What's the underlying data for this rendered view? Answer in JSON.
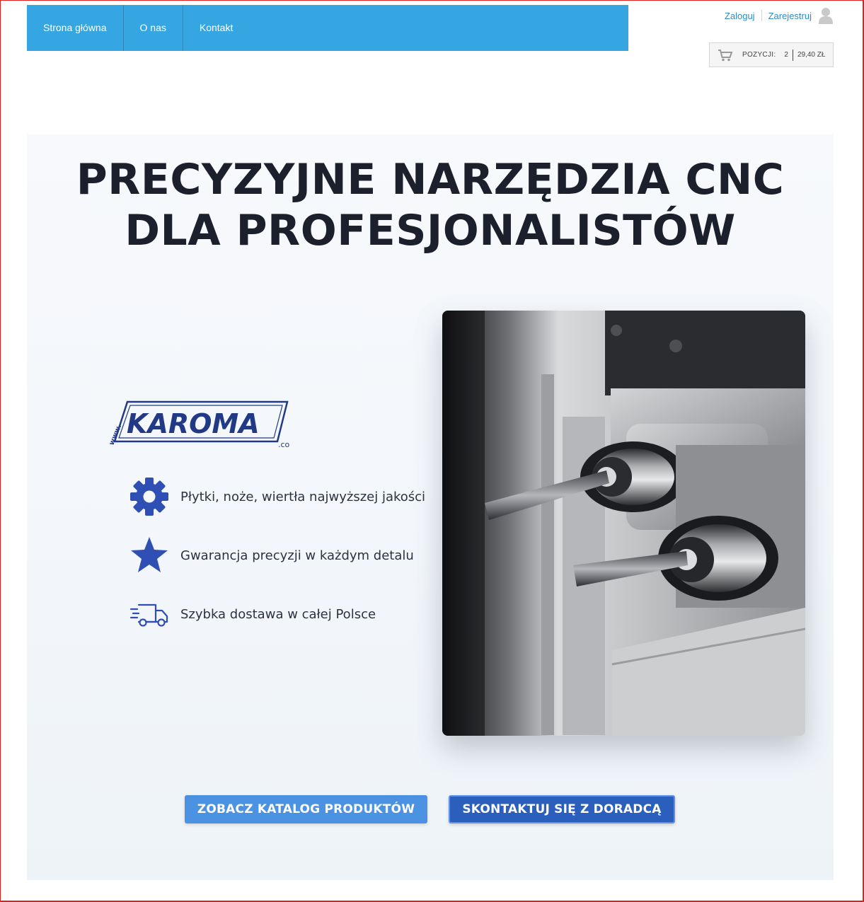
{
  "nav": {
    "items": [
      {
        "label": "Strona główna"
      },
      {
        "label": "O nas"
      },
      {
        "label": "Kontakt"
      }
    ]
  },
  "account": {
    "login_label": "Zaloguj",
    "register_label": "Zarejestruj",
    "icon": "user-icon"
  },
  "cart": {
    "icon": "cart-icon",
    "positions_label": "POZYCJI:",
    "count": "2",
    "total": "29,40 ZŁ"
  },
  "hero": {
    "title_line1": "PRECYZYJNE NARZĘDZIA CNC",
    "title_line2": "DLA PROFESJONALISTÓW",
    "logo": {
      "prefix": "www.",
      "name": "KAROMA",
      "suffix": ".co"
    },
    "features": [
      {
        "icon": "gear-icon",
        "text": "Płytki, noże, wiertła najwyższej jakości"
      },
      {
        "icon": "star-icon",
        "text": "Gwarancja precyzji w każdym detalu"
      },
      {
        "icon": "truck-icon",
        "text": "Szybka dostawa w całej Polsce"
      }
    ],
    "primary_button": "ZOBACZ KATALOG PRODUKTÓW",
    "secondary_button": "SKONTAKTUJ SIĘ Z DORADCĄ"
  },
  "colors": {
    "nav_bg": "#35a6e2",
    "link": "#2e8bc6",
    "icon_blue": "#2f4fb5",
    "title": "#1b202c",
    "primary_button": "#4b92e3",
    "secondary_button": "#2a5fbe"
  }
}
